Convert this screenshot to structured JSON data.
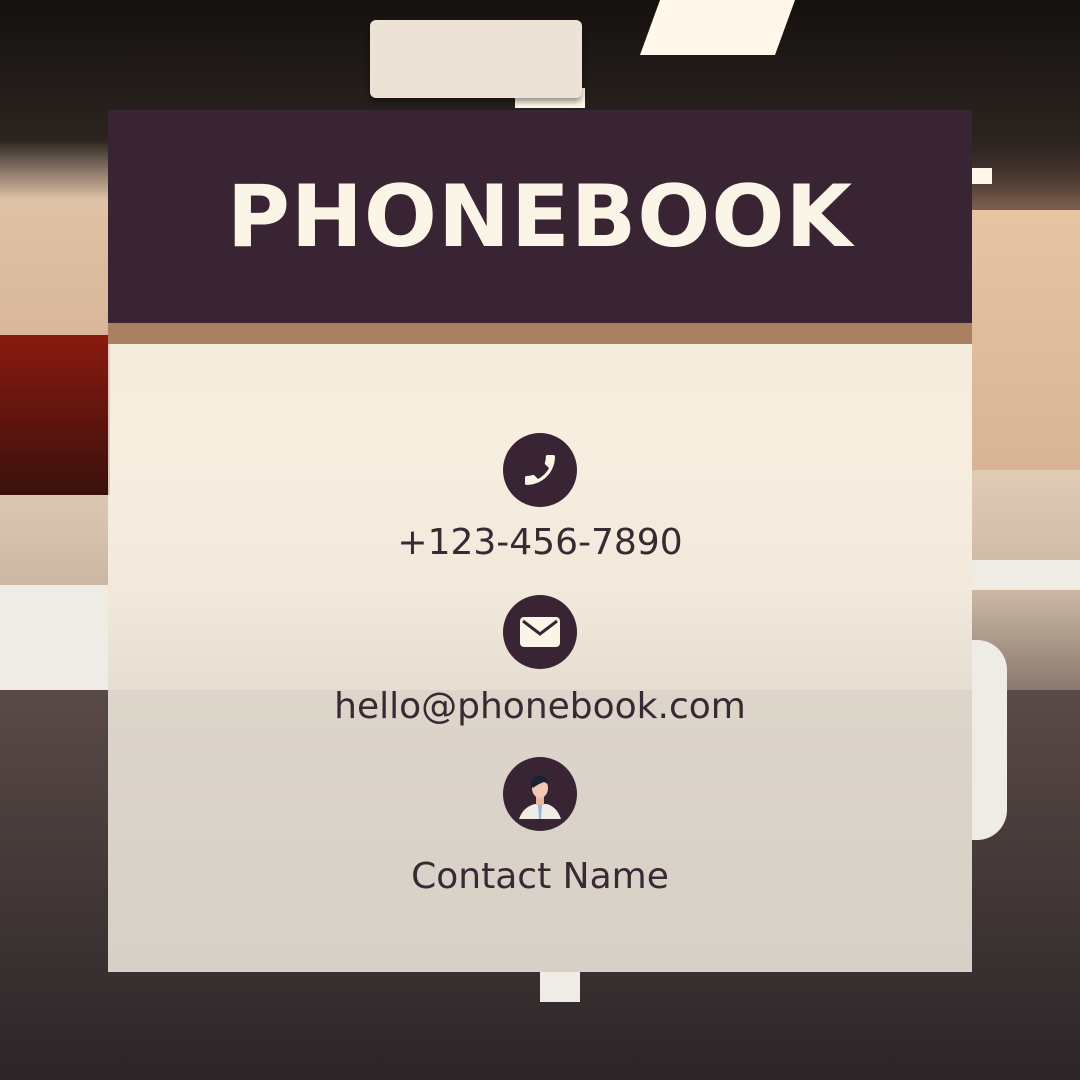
{
  "title": "PHONEBOOK",
  "phone": {
    "icon": "phone-icon",
    "value": "+123-456-7890"
  },
  "email": {
    "icon": "envelope-icon",
    "value": "hello@phonebook.com"
  },
  "contact": {
    "icon": "avatar-icon",
    "name": "Contact Name"
  },
  "colors": {
    "header": "#382432",
    "band": "#a98062",
    "title_text": "#fbf5e8",
    "body_text": "#3a2832"
  }
}
